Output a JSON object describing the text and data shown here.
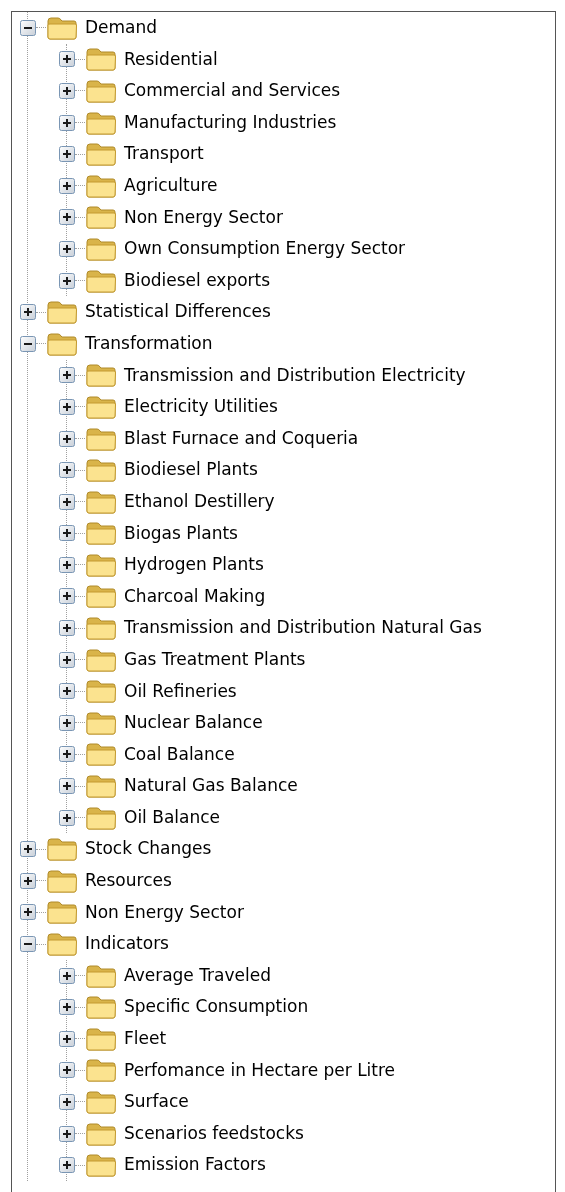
{
  "tree": [
    {
      "label": "Demand",
      "expanded": true,
      "children": [
        {
          "label": "Residential",
          "expanded": false
        },
        {
          "label": "Commercial and Services",
          "expanded": false
        },
        {
          "label": "Manufacturing Industries",
          "expanded": false
        },
        {
          "label": "Transport",
          "expanded": false
        },
        {
          "label": "Agriculture",
          "expanded": false
        },
        {
          "label": "Non Energy Sector",
          "expanded": false
        },
        {
          "label": "Own Consumption Energy Sector",
          "expanded": false
        },
        {
          "label": "Biodiesel exports",
          "expanded": false
        }
      ]
    },
    {
      "label": "Statistical Differences",
      "expanded": false
    },
    {
      "label": "Transformation",
      "expanded": true,
      "children": [
        {
          "label": "Transmission and Distribution Electricity",
          "expanded": false
        },
        {
          "label": "Electricity Utilities",
          "expanded": false
        },
        {
          "label": "Blast Furnace and Coqueria",
          "expanded": false
        },
        {
          "label": "Biodiesel Plants",
          "expanded": false
        },
        {
          "label": "Ethanol Destillery",
          "expanded": false
        },
        {
          "label": "Biogas Plants",
          "expanded": false
        },
        {
          "label": "Hydrogen Plants",
          "expanded": false
        },
        {
          "label": "Charcoal Making",
          "expanded": false
        },
        {
          "label": "Transmission and Distribution Natural Gas",
          "expanded": false
        },
        {
          "label": "Gas Treatment Plants",
          "expanded": false
        },
        {
          "label": "Oil Refineries",
          "expanded": false
        },
        {
          "label": "Nuclear Balance",
          "expanded": false
        },
        {
          "label": "Coal Balance",
          "expanded": false
        },
        {
          "label": "Natural Gas Balance",
          "expanded": false
        },
        {
          "label": "Oil Balance",
          "expanded": false
        }
      ]
    },
    {
      "label": "Stock Changes",
      "expanded": false
    },
    {
      "label": "Resources",
      "expanded": false
    },
    {
      "label": "Non Energy Sector",
      "expanded": false
    },
    {
      "label": "Indicators",
      "expanded": true,
      "children": [
        {
          "label": "Average Traveled",
          "expanded": false
        },
        {
          "label": "Specific Consumption",
          "expanded": false
        },
        {
          "label": "Fleet",
          "expanded": false
        },
        {
          "label": "Perfomance in Hectare per Litre",
          "expanded": false
        },
        {
          "label": "Surface",
          "expanded": false
        },
        {
          "label": "Scenarios feedstocks",
          "expanded": false
        },
        {
          "label": "Emission Factors",
          "expanded": false
        }
      ]
    }
  ]
}
